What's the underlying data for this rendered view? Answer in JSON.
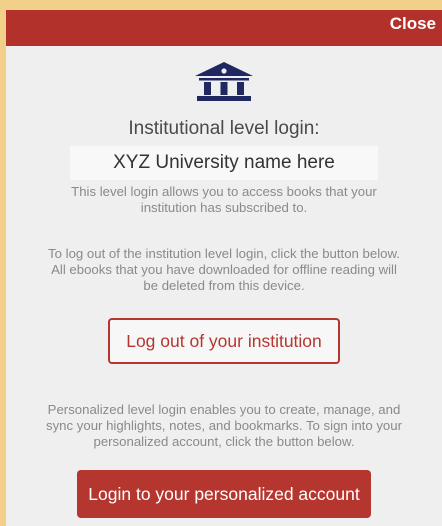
{
  "header": {
    "close_label": "Close"
  },
  "icon": "institution-icon",
  "title": "Institutional level login:",
  "institution_name": "XYZ University name here",
  "institution_desc": "This level login allows you to access books that your institution has subscribed to.",
  "logout_desc": "To log out of the institution level login, click the button below. All ebooks that you have downloaded for offline reading will be deleted from this device.",
  "logout_button": "Log out of your institution",
  "personal_desc": "Personalized level login enables you to create, manage, and sync your highlights, notes, and bookmarks. To sign into your personalized account, click the button below.",
  "login_button": "Login to your personalized account",
  "colors": {
    "accent": "#b5362f",
    "header": "#b2312a",
    "icon": "#1f2860",
    "background": "#efefef",
    "outer": "#f2d08a"
  }
}
